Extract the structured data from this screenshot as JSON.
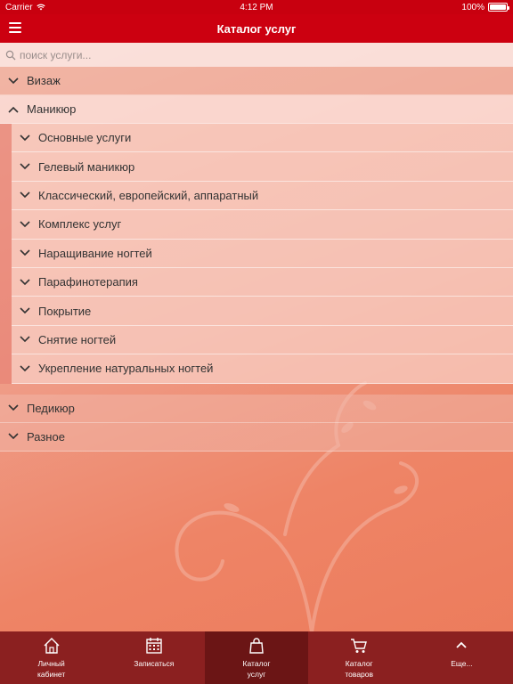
{
  "status": {
    "carrier": "Carrier",
    "time": "4:12 PM",
    "battery": "100%"
  },
  "navbar": {
    "title": "Каталог услуг",
    "menu_icon": "menu-icon"
  },
  "search": {
    "placeholder": "поиск услуги..."
  },
  "categories": [
    {
      "label": "Визаж",
      "expanded": false
    },
    {
      "label": "Маникюр",
      "expanded": true
    },
    {
      "label": "Педикюр",
      "expanded": false
    },
    {
      "label": "Разное",
      "expanded": false
    }
  ],
  "manicure_items": [
    "Основные услуги",
    "Гелевый маникюр",
    "Классический, европейский, аппаратный",
    "Комплекс услуг",
    "Наращивание ногтей",
    "Парафинотерапия",
    "Покрытие",
    "Снятие ногтей",
    "Укрепление натуральных ногтей"
  ],
  "tabs": [
    {
      "label": "Личный\nкабинет",
      "icon": "home-icon",
      "active": false
    },
    {
      "label": "Записаться",
      "icon": "calendar-icon",
      "active": false
    },
    {
      "label": "Каталог\nуслуг",
      "icon": "shopping-bag-icon",
      "active": true
    },
    {
      "label": "Каталог\nтоваров",
      "icon": "cart-icon",
      "active": false
    },
    {
      "label": "Еще...",
      "icon": "chevron-up-icon",
      "active": false
    }
  ],
  "colors": {
    "accent": "#cc0010",
    "tabbar": "#8b2020",
    "tabbar_active": "#6b1515"
  }
}
